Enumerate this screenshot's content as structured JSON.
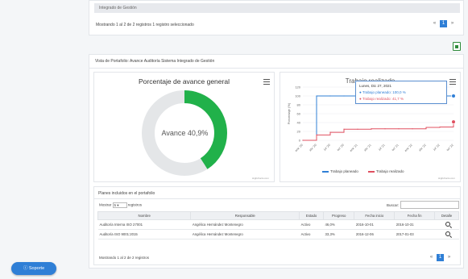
{
  "top_panel": {
    "header": "Integrado de Gestión",
    "info": "Mostrando 1 al 2 de 2 registros   1 registro seleccionado",
    "pager": [
      "«",
      "1",
      "»"
    ]
  },
  "main_panel": {
    "title": "Vista de Portafolio: Avance Auditoría Sistema Integrado de Gestión"
  },
  "donut": {
    "title": "Porcentaje de avance general",
    "center_label": "Avance 40,9%",
    "percent": 40.9,
    "credit": "Highcharts.com",
    "colors": {
      "done": "#21b14a",
      "remaining": "#e4e6e8"
    }
  },
  "line_chart": {
    "title": "Trabajo realizado",
    "tooltip": {
      "date": "Lunes, Dic 27, 2021",
      "planned": "● Trabajo planeado: 100,0 %",
      "done": "● Trabajo realizado: 41,7 %"
    },
    "legend_planned": "Trabajo planeado",
    "legend_done": "Trabajo realizado",
    "credit": "Highcharts.com"
  },
  "chart_data": {
    "type": "line",
    "title": "Trabajo realizado",
    "ylabel": "Porcentaje (%)",
    "ylim": [
      0,
      120
    ],
    "yticks": [
      "0",
      "20",
      "40",
      "60",
      "80",
      "100",
      "120"
    ],
    "x": [
      "ene '20",
      "abr '20",
      "jul '20",
      "oct '20",
      "ene '21",
      "abr '21",
      "jul '21",
      "oct '21",
      "ene '22",
      "abr '22",
      "jul '22",
      "oct '22"
    ],
    "series": [
      {
        "name": "Trabajo planeado",
        "color": "#2f7fd6",
        "values": [
          0,
          100,
          100,
          100,
          100,
          100,
          100,
          100,
          100,
          100,
          100,
          100
        ]
      },
      {
        "name": "Trabajo realizado",
        "color": "#e05060",
        "values": [
          0,
          12,
          18,
          25,
          25,
          26,
          26,
          26,
          26,
          29,
          30,
          41.7
        ]
      }
    ]
  },
  "table": {
    "title": "Planes incluidos en el portafolio",
    "show_prefix": "Mostrar",
    "show_value": "5",
    "show_suffix": "registros",
    "search_label": "Buscar:",
    "columns": [
      "Nombre",
      "Responsable",
      "Estado",
      "Progreso",
      "Fecha inicio",
      "Fecha fin",
      "Detalle"
    ],
    "rows": [
      [
        "Auditoría Interna ISO 27001",
        "Angélica Hernández Montenegro",
        "Activo",
        "46,0%",
        "2016-10-01",
        "2016-10-31"
      ],
      [
        "Auditoría ISO 9001:2015",
        "Angélica Hernández Montenegro",
        "Activo",
        "33,3%",
        "2016-12-06",
        "2017-01-03"
      ]
    ],
    "info": "Mostrando 1 al 2 de 2 registros",
    "pager": [
      "«",
      "1",
      "»"
    ]
  },
  "support_button": "Soporte"
}
